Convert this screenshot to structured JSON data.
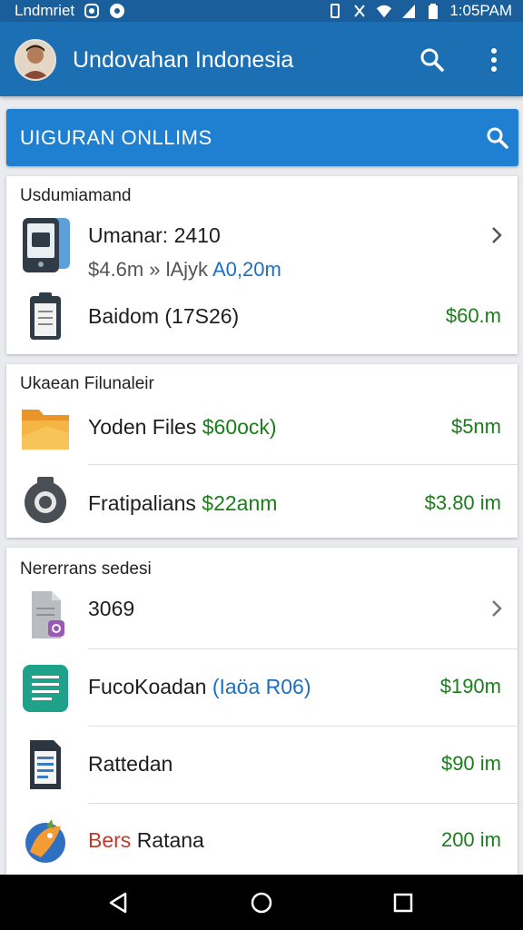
{
  "status_bar": {
    "carrier": "Lndmriet",
    "time": "1:05PAM"
  },
  "app_bar": {
    "title": "Undovahan Indonesia"
  },
  "search_bar": {
    "label": "UIGURAN ONLLIMS"
  },
  "sections": [
    {
      "title": "Usdumiamand",
      "rows": [
        {
          "title": "Umanar: 2410",
          "subtitle_a": "$4.6m » lAjyk",
          "subtitle_b": "A0,20m",
          "value": "",
          "icon": "phone-card-icon"
        },
        {
          "title": "Baidom (17S26)",
          "value": "$60.m",
          "icon": "clipboard-icon"
        }
      ]
    },
    {
      "title": "Ukaean Filunaleir",
      "rows": [
        {
          "title_a": "Yoden Files",
          "title_b": "$60ock)",
          "value": "$5nm",
          "icon": "folder-icon"
        },
        {
          "title_a": "Fratipalians",
          "title_b": "$22anm",
          "value": "$3.80 im",
          "icon": "camera-icon"
        }
      ]
    },
    {
      "title": "Nererrans sedesi",
      "rows": [
        {
          "title": "3069",
          "value": "",
          "icon": "document-badge-icon"
        },
        {
          "title_a": "FucoKoadan",
          "title_b": "(Iaöa R06)",
          "value": "$190m",
          "icon": "notes-app-icon"
        },
        {
          "title": "Rattedan",
          "value": "$90 im",
          "icon": "text-file-icon"
        },
        {
          "title_a": "Bers",
          "title_b": "Ratana",
          "value": "200 im",
          "icon": "fox-app-icon"
        }
      ]
    }
  ],
  "colors": {
    "app_bar": "#1d6fb3",
    "search_bar": "#1f7fd1",
    "value_green": "#1a7d1a",
    "link_blue": "#1f6fc1"
  }
}
